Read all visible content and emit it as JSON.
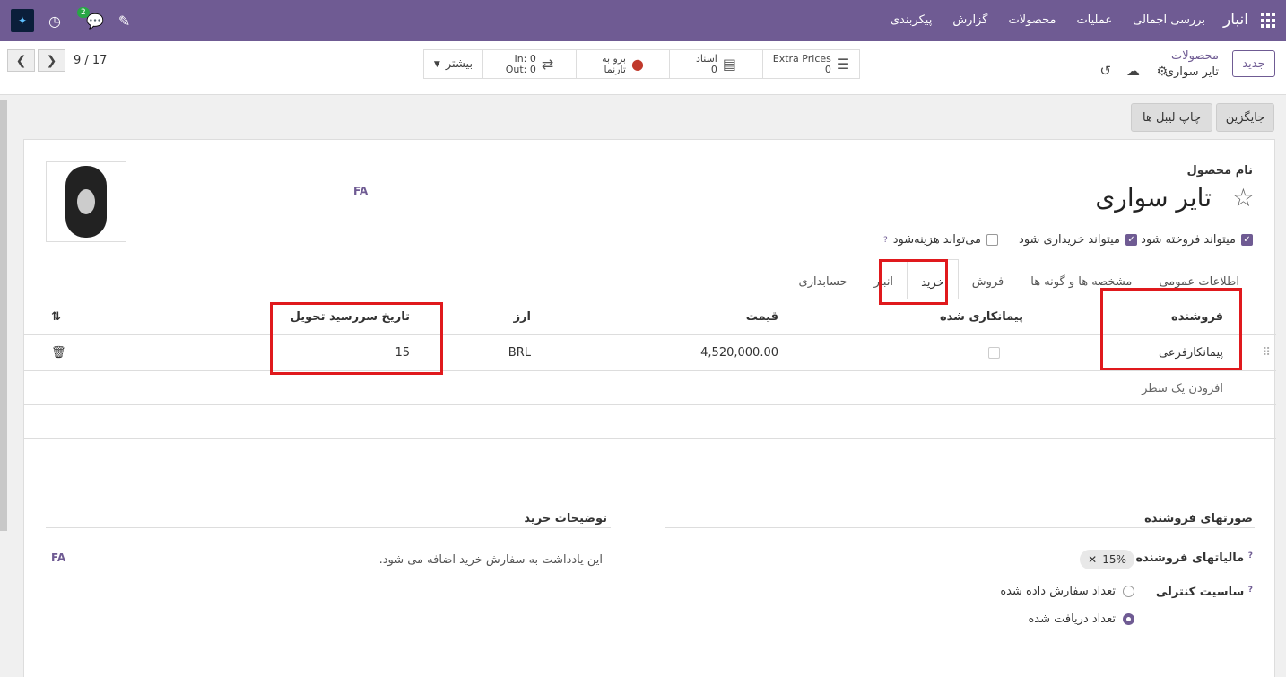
{
  "navbar": {
    "app_name": "انبار",
    "menu": [
      "بررسی اجمالی",
      "عملیات",
      "محصولات",
      "گزارش",
      "پیکربندی"
    ],
    "chat_badge": "2",
    "avatar_text": "✦"
  },
  "control_panel": {
    "new_button": "جدید",
    "breadcrumb_parent": "محصولات",
    "breadcrumb_current": "تایر سواری",
    "smart_buttons": {
      "extra_prices_label": "Extra Prices",
      "extra_prices_value": "0",
      "documents_label": "اسناد",
      "documents_value": "0",
      "website_label": "برو به",
      "website_label2": "تارنما",
      "in_label": "In: 0",
      "out_label": "Out: 0",
      "more_label": "بیشتر"
    },
    "pager": "9 / 17"
  },
  "header_buttons": {
    "replenish": "جایگزین",
    "print_labels": "چاپ لیبل ها"
  },
  "form": {
    "lang_badge": "FA",
    "product_name_label": "نام محصول",
    "product_name": "تایر سواری",
    "checkboxes": [
      {
        "label": "میتواند فروخته شود",
        "checked": true
      },
      {
        "label": "میتواند خریداری شود",
        "checked": true
      },
      {
        "label": "می‌تواند هزینه‌شود",
        "checked": false
      }
    ],
    "tabs": [
      "اطلاعات عمومی",
      "مشخصه ها و گونه ها",
      "فروش",
      "خرید",
      "انبار",
      "حسابداری"
    ],
    "active_tab": "خرید"
  },
  "vendor_table": {
    "headers": {
      "vendor": "فروشنده",
      "subcontracted": "پیمانکاری شده",
      "price": "قیمت",
      "currency": "ارز",
      "lead_time": "تاریخ سررسید تحویل"
    },
    "rows": [
      {
        "vendor": "پیمانکارفرعی",
        "subcontracted": false,
        "price": "4,520,000.00",
        "currency": "BRL",
        "lead_time": "15"
      }
    ],
    "add_line": "افزودن یک سطر"
  },
  "sections": {
    "vendor_bills": "صورتهای فروشنده",
    "vendor_taxes_label": "مالیاتهای فروشنده",
    "vendor_tax_tag": "15%",
    "control_policy_label": "ساسیت کنترلی",
    "control_options": [
      {
        "label": "تعداد سفارش داده شده",
        "selected": false
      },
      {
        "label": "تعداد دریافت شده",
        "selected": true
      }
    ],
    "purchase_description": "توضیحات خرید",
    "purchase_note": "این یادداشت به سفارش خرید اضافه می شود.",
    "note_lang": "FA"
  },
  "colors": {
    "brand": "#6f5b93",
    "highlight": "#e0191d"
  }
}
